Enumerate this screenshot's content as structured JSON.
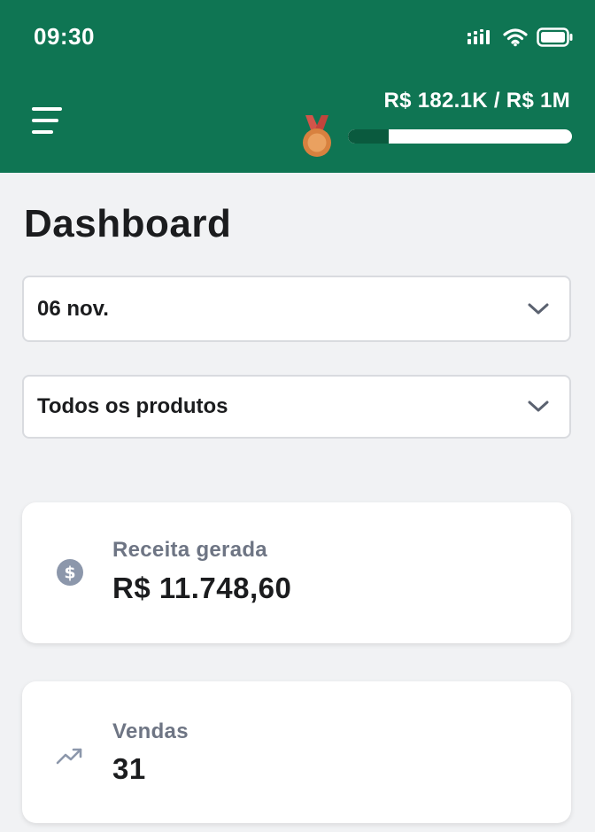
{
  "status_bar": {
    "time": "09:30",
    "icons": [
      "signal-icon",
      "wifi-icon",
      "battery-icon"
    ]
  },
  "header": {
    "menu_icon": "hamburger-menu-icon",
    "goal_text": "R$ 182.1K / R$ 1M",
    "goal_progress_fraction": 0.182,
    "medal_icon": "bronze-medal-icon",
    "colors": {
      "background": "#0f7553",
      "progress_fill": "#0a5a3e",
      "progress_track": "#ffffff"
    }
  },
  "page": {
    "title": "Dashboard"
  },
  "filters": {
    "date": {
      "value": "06 nov.",
      "icon": "chevron-down-icon"
    },
    "products": {
      "value": "Todos os produtos",
      "icon": "chevron-down-icon"
    }
  },
  "cards": {
    "revenue": {
      "label": "Receita gerada",
      "value": "R$ 11.748,60",
      "icon": "dollar-circle-icon"
    },
    "sales": {
      "label": "Vendas",
      "value": "31",
      "icon": "trending-up-icon"
    }
  }
}
